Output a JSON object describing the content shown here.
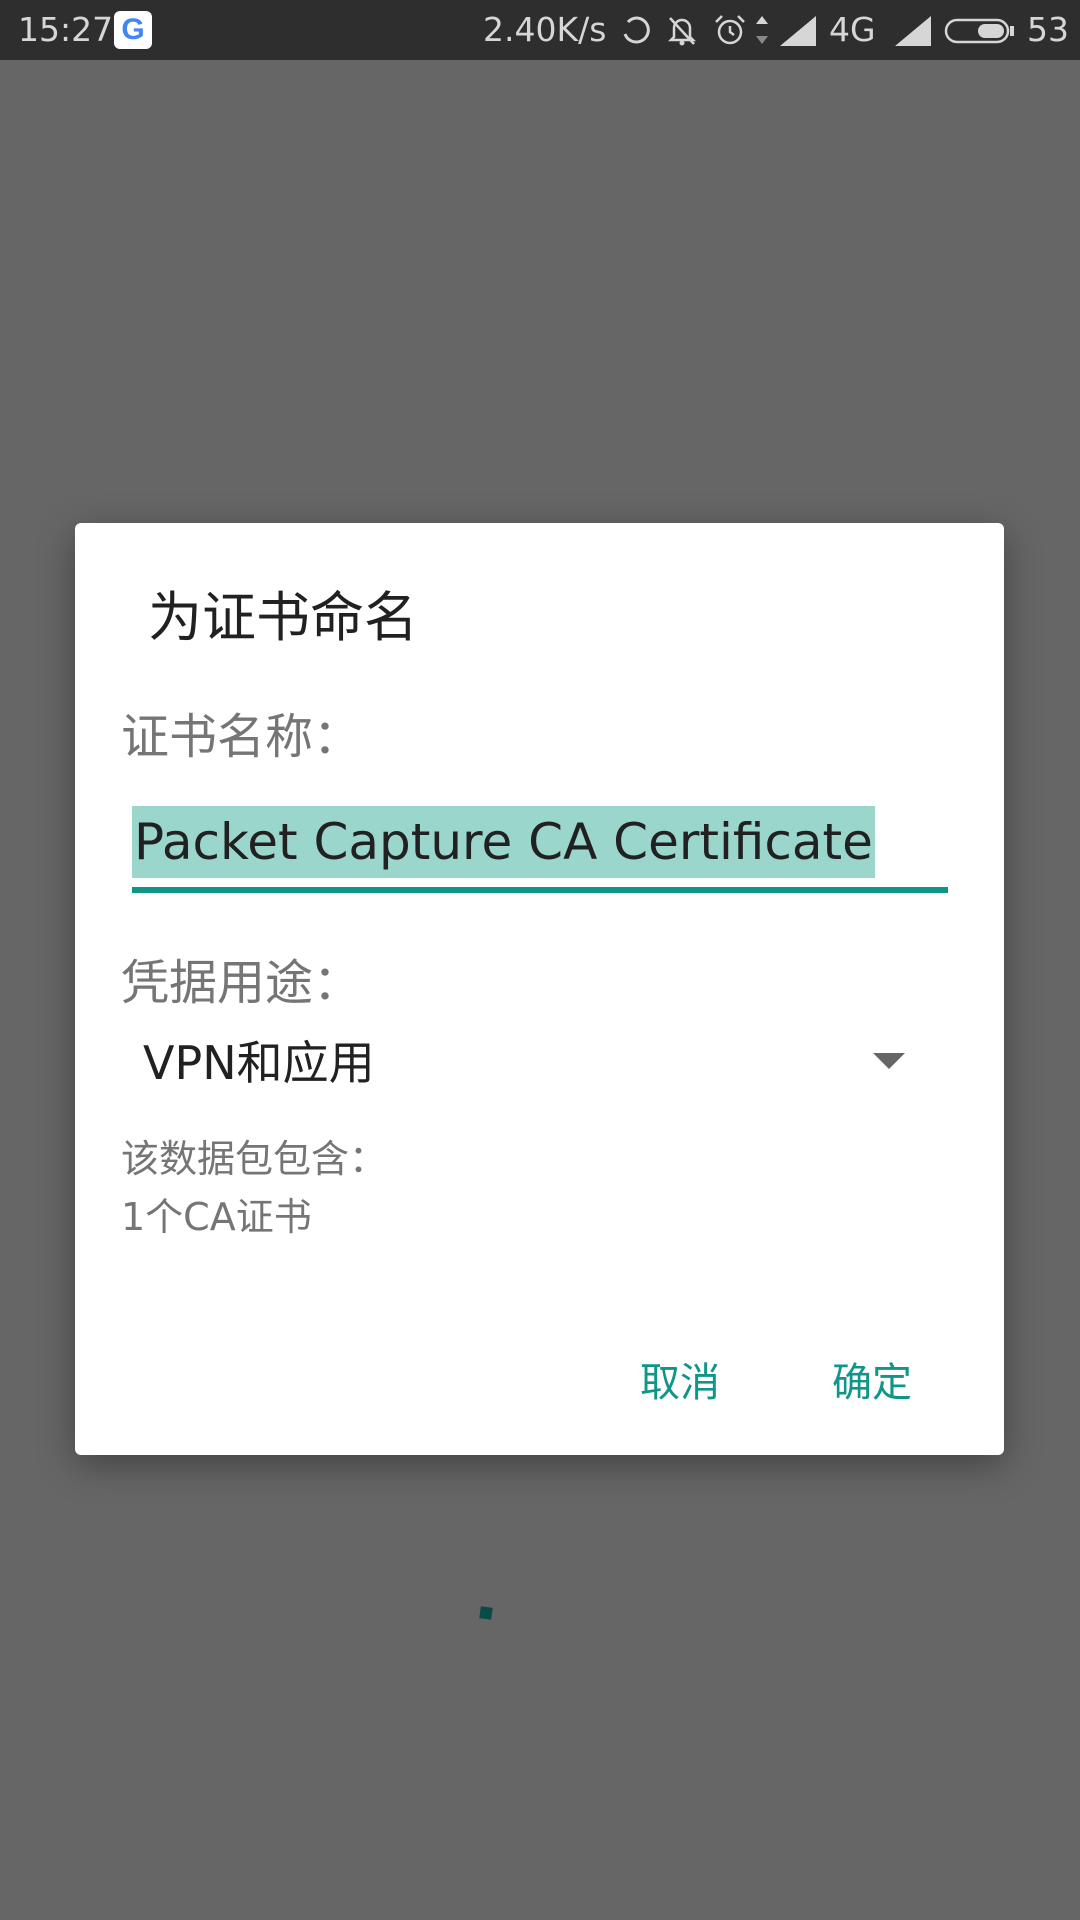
{
  "status_bar": {
    "time": "15:27",
    "google_badge": "G",
    "net_speed": "2.40K/s",
    "network_type": "4G",
    "battery_level": "53",
    "icons": [
      "google-icon",
      "sync-icon",
      "bell-muted-icon",
      "alarm-icon",
      "data-arrows-icon",
      "signal-icon",
      "signal-icon",
      "battery-icon"
    ]
  },
  "dialog": {
    "title": "为证书命名",
    "cert_name_label": "证书名称：",
    "cert_name_value": "Packet Capture CA Certificate",
    "usage_label": "凭据用途：",
    "usage_value": "VPN和应用",
    "package_label": "该数据包包含：",
    "package_items": [
      "1个CA证书"
    ],
    "cancel_label": "取消",
    "ok_label": "确定"
  },
  "colors": {
    "accent": "#0f9688",
    "selection": "#9bd6cd",
    "scrim": "#666666",
    "status_bar": "#2e2e2e"
  }
}
